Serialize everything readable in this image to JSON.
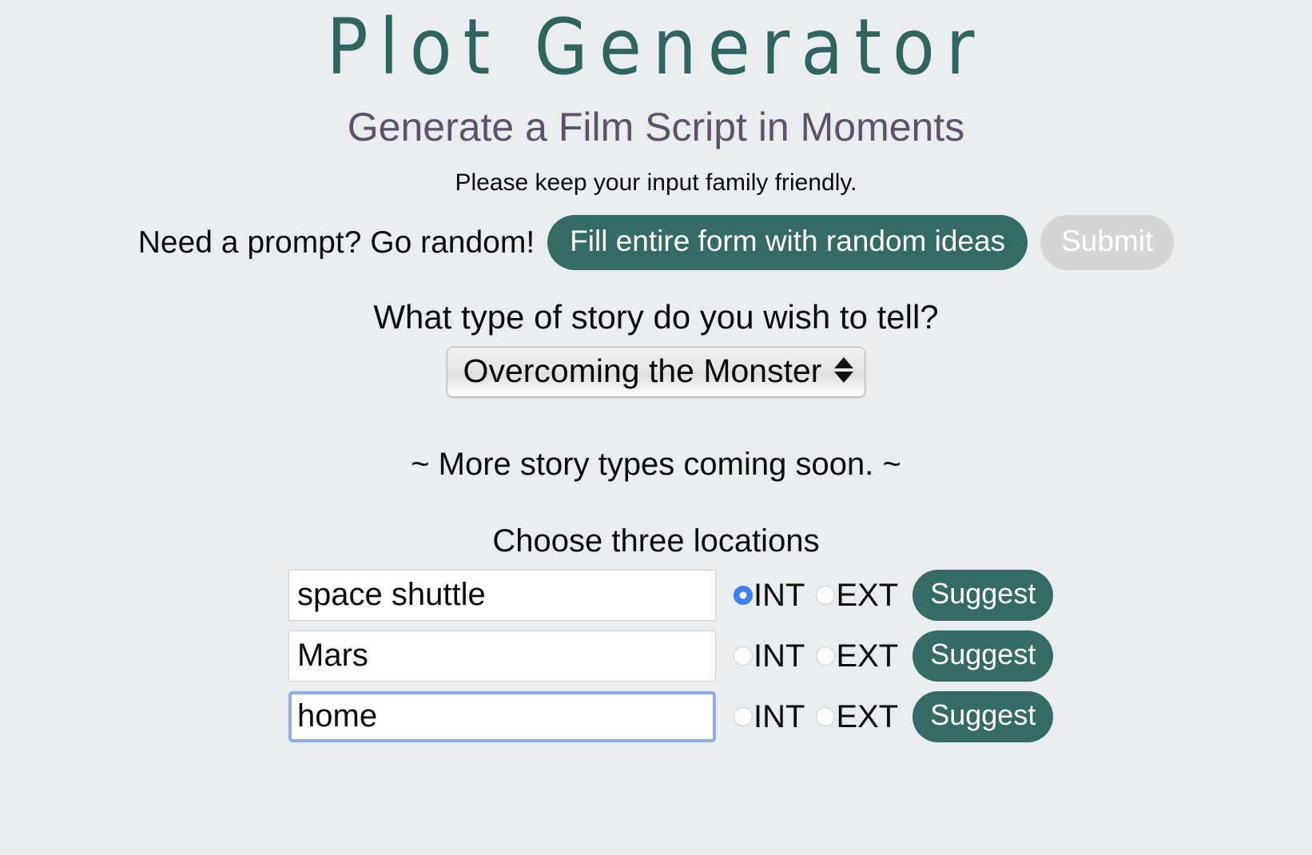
{
  "header": {
    "title": "Plot Generator",
    "subtitle": "Generate a Film Script in Moments",
    "notice": "Please keep your input family friendly."
  },
  "random_prompt": {
    "label": "Need a prompt? Go random!",
    "fill_button": "Fill entire form with random ideas",
    "submit_button": "Submit"
  },
  "story_type": {
    "question": "What type of story do you wish to tell?",
    "selected": "Overcoming the Monster",
    "options": [
      "Overcoming the Monster"
    ],
    "coming_soon": "~ More story types coming soon. ~"
  },
  "locations": {
    "heading": "Choose three locations",
    "int_label": "INT",
    "ext_label": "EXT",
    "suggest_label": "Suggest",
    "rows": [
      {
        "value": "space shuttle",
        "placeholder": "",
        "int_checked": true,
        "ext_checked": false,
        "focused": false
      },
      {
        "value": "Mars",
        "placeholder": "",
        "int_checked": false,
        "ext_checked": false,
        "focused": false
      },
      {
        "value": "home",
        "placeholder": "",
        "int_checked": false,
        "ext_checked": false,
        "focused": true
      }
    ]
  },
  "colors": {
    "background": "#e9edf0",
    "title_teal": "#30655f",
    "subtitle_mauve": "#5e5268",
    "button_teal": "#346b65",
    "submit_gray": "#d5d5d5",
    "radio_blue": "#3b82f0",
    "focus_blue": "#8fadea"
  }
}
